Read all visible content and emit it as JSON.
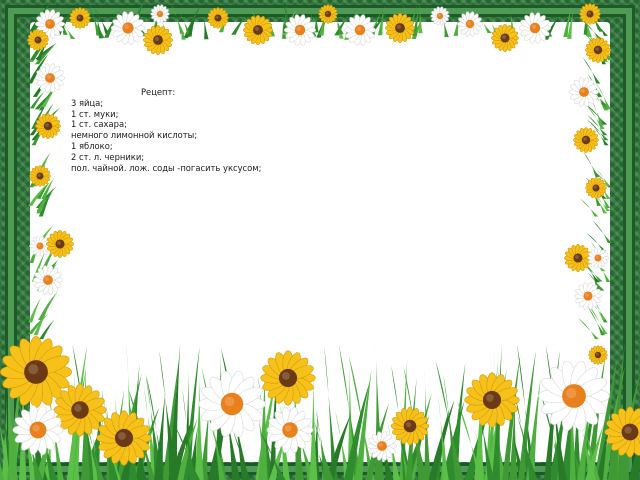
{
  "recipe": {
    "title": "Рецепт:",
    "lines": [
      "3 яйца;",
      "1 ст. муки;",
      "1 ст. сахара;",
      "немного лимонной кислоты;",
      "1 яблоко;",
      "2 ст. л. черники;",
      "пол. чайной. лож. соды -погасить уксусом;"
    ]
  },
  "colors": {
    "frame_green": "#2f7a3b",
    "paper": "#ffffff",
    "grass": "#3f9a35",
    "sunflower_petal": "#f6c21a",
    "daisy_petal": "#ffffff",
    "flower_center_orange": "#e9801c",
    "flower_center_brown": "#6b3a12"
  },
  "decoration": {
    "border_flower_icon": "daisy-flower-icon",
    "large_flower_icon": "sunflower-icon",
    "grass_icon": "grass-blades-icon"
  }
}
